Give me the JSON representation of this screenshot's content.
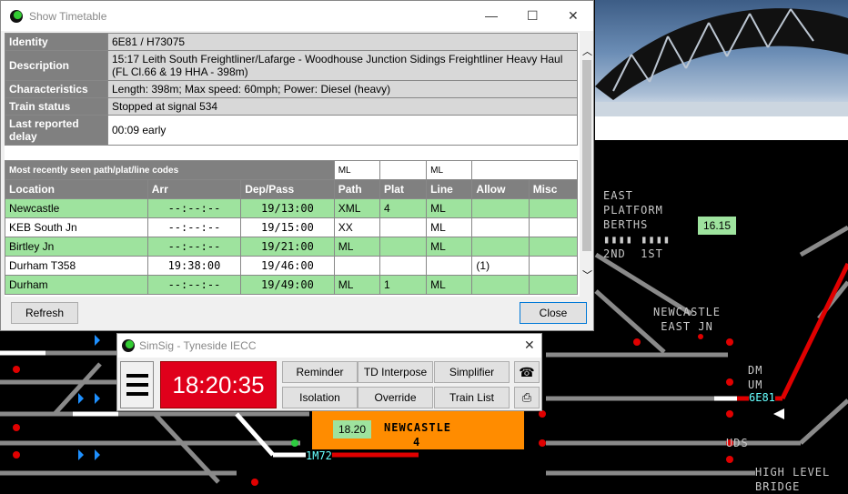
{
  "timetable_window": {
    "title": "Show Timetable",
    "info": [
      {
        "key": "Identity",
        "value": "6E81 / H73075"
      },
      {
        "key": "Description",
        "value": "15:17 Leith South Freightliner/Lafarge - Woodhouse Junction Sidings Freightliner Heavy Haul (FL Cl.66 & 19 HHA - 398m)"
      },
      {
        "key": "Characteristics",
        "value": "Length: 398m; Max speed: 60mph; Power: Diesel (heavy)"
      },
      {
        "key": "Train status",
        "value": "Stopped at signal 534"
      },
      {
        "key": "Last reported delay",
        "value": "00:09 early"
      }
    ],
    "codes_label": "Most recently seen path/plat/line codes",
    "codes_path": "ML",
    "codes_line": "ML",
    "columns": [
      "Location",
      "Arr",
      "Dep/Pass",
      "Path",
      "Plat",
      "Line",
      "Allow",
      "Misc"
    ],
    "rows": [
      {
        "location": "Newcastle",
        "arr": "--:--:--",
        "dep": "19/13:00",
        "path": "XML",
        "plat": "4",
        "line": "ML",
        "allow": "",
        "misc": ""
      },
      {
        "location": "KEB South Jn",
        "arr": "--:--:--",
        "dep": "19/15:00",
        "path": "XX",
        "plat": "",
        "line": "ML",
        "allow": "",
        "misc": ""
      },
      {
        "location": "Birtley Jn",
        "arr": "--:--:--",
        "dep": "19/21:00",
        "path": "ML",
        "plat": "",
        "line": "ML",
        "allow": "",
        "misc": ""
      },
      {
        "location": "Durham T358",
        "arr": "19:38:00",
        "dep": "19/46:00",
        "path": "",
        "plat": "",
        "line": "",
        "allow": "(1)",
        "misc": ""
      },
      {
        "location": "Durham",
        "arr": "--:--:--",
        "dep": "19/49:00",
        "path": "ML",
        "plat": "1",
        "line": "ML",
        "allow": "",
        "misc": ""
      }
    ],
    "refresh_label": "Refresh",
    "close_label": "Close"
  },
  "simsig_window": {
    "title": "SimSig - Tyneside IECC",
    "clock": "18:20:35",
    "buttons": [
      "Reminder",
      "TD Interpose",
      "Simplifier",
      "Isolation",
      "Override",
      "Train List"
    ]
  },
  "diagram": {
    "east_platform": "EAST\nPLATFORM\nBERTHS",
    "berth_boxes": "▮▮▮▮ ▮▮▮▮",
    "berth_labels": "2ND  1ST",
    "east_time": "16.15",
    "newcastle_east_jn": "NEWCASTLE\nEAST JN",
    "newcastle_time": "18.20",
    "newcastle_name": "NEWCASTLE",
    "newcastle_platform": "4",
    "berth_6e81": "6E81",
    "berth_1m72": "1M72",
    "dm": "DM",
    "um": "UM",
    "uds": "UDS",
    "high_level": "HIGH LEVEL\nBRIDGE",
    "colors": {
      "track_red": "#e00000",
      "track_white": "#ffffff",
      "track_grey": "#8a8a8a",
      "platform": "#ff8c00",
      "berth": "#66ffff"
    }
  }
}
